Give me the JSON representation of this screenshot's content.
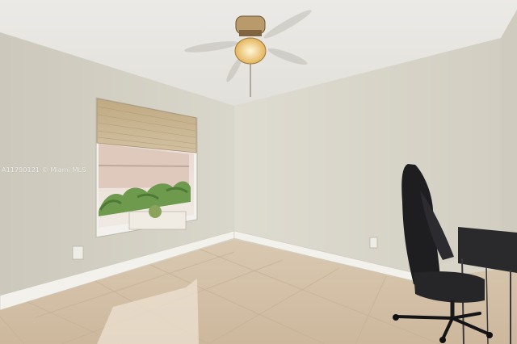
{
  "photo": {
    "subject": "empty bedroom with ceiling fan, window with roller shade, tile floor, gaming chair and desk",
    "watermark_text": "A11790121 © Miami MLS"
  },
  "colors": {
    "ceiling": "#e6e5e0",
    "wall_left": "#d5d1c5",
    "wall_back": "#d9d5c9",
    "floor": "#d7c5ae",
    "baseboard": "#f1efea",
    "shade": "#c8b596",
    "chair": "#1f1f22",
    "foliage": "#6e9a4e"
  }
}
